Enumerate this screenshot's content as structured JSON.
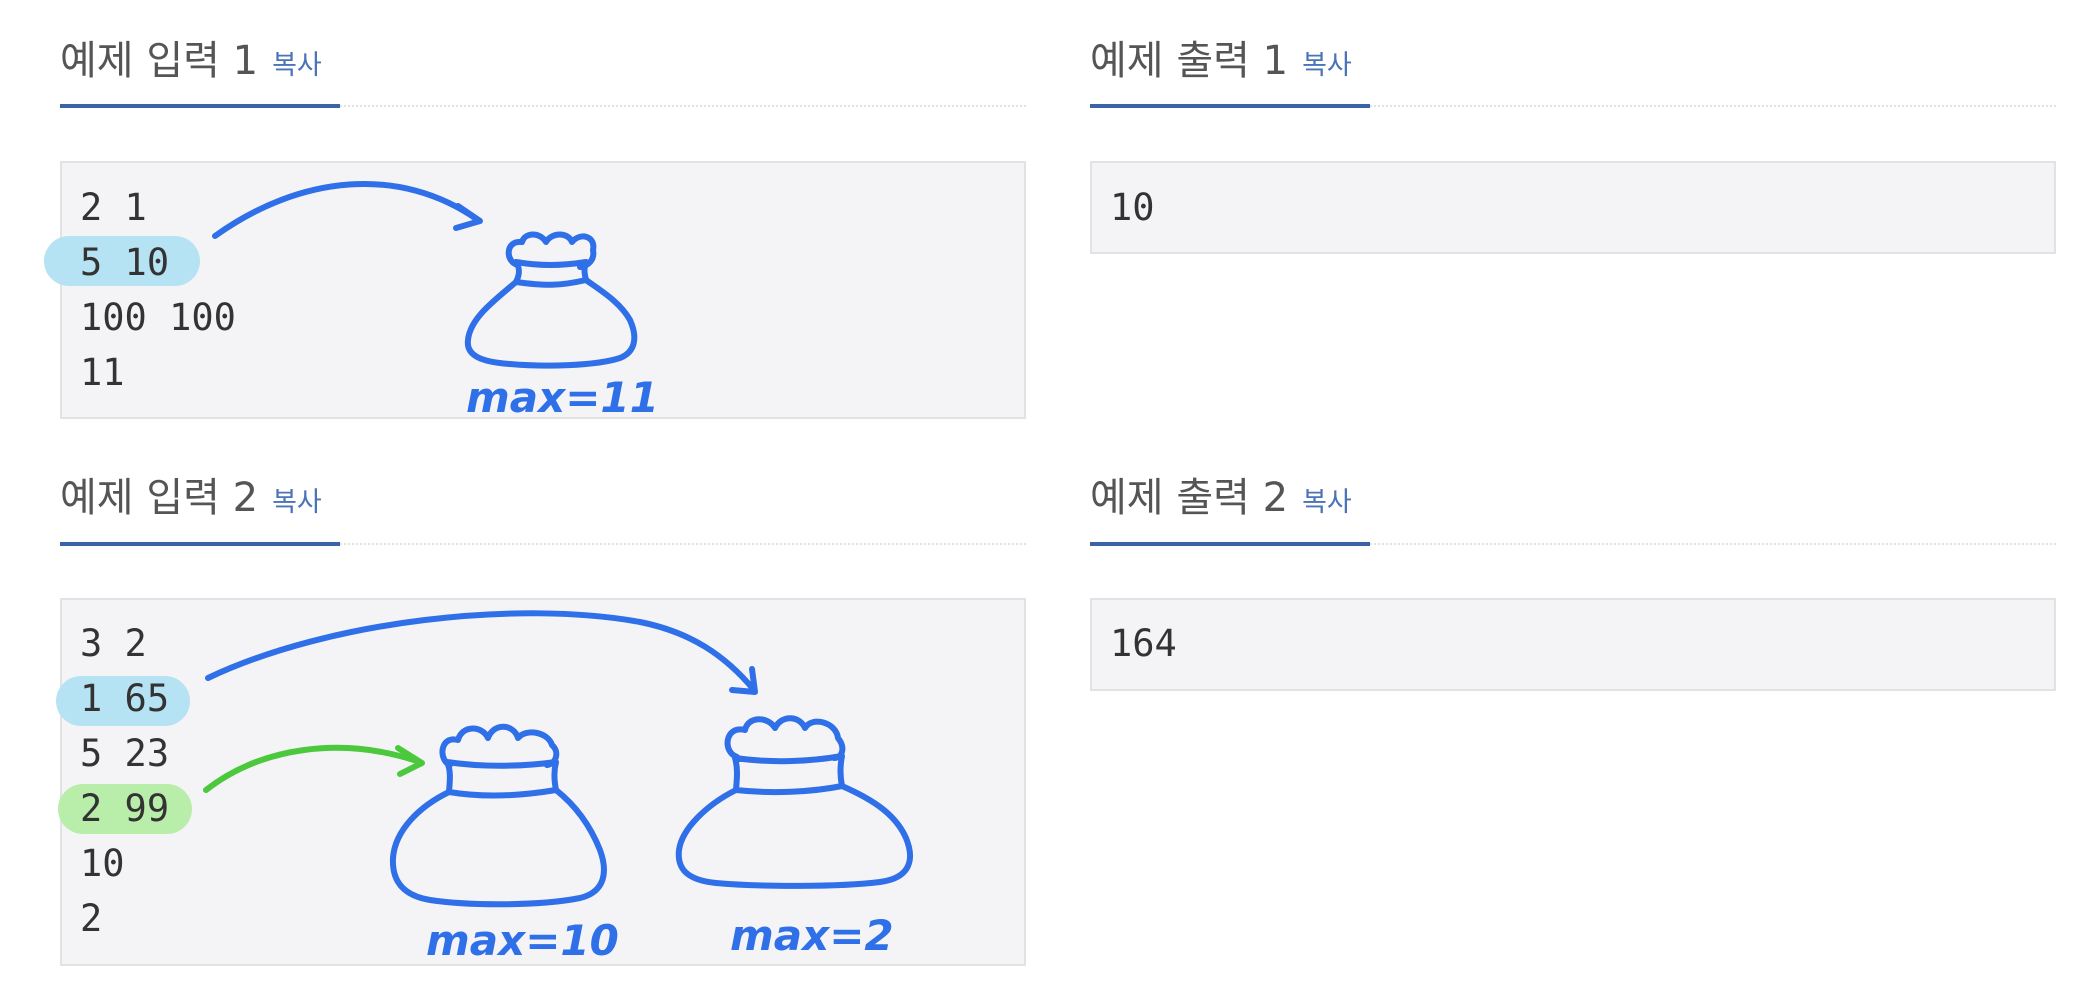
{
  "sample_input_1": {
    "title": "예제 입력 1",
    "copy_label": "복사",
    "lines": [
      "2 1",
      "5 10",
      "100 100",
      "11"
    ]
  },
  "sample_output_1": {
    "title": "예제 출력 1",
    "copy_label": "복사",
    "lines": [
      "10"
    ]
  },
  "sample_input_2": {
    "title": "예제 입력 2",
    "copy_label": "복사",
    "lines": [
      "3 2",
      "1 65",
      "5 23",
      "2 99",
      "10",
      "2"
    ]
  },
  "sample_output_2": {
    "title": "예제 출력 2",
    "copy_label": "복사",
    "lines": [
      "164"
    ]
  },
  "annotations": {
    "bag_1_label": "max=11",
    "bag_2_label": "max=10",
    "bag_3_label": "max=2",
    "colors": {
      "blue_ink": "#2f6fe8",
      "green_ink": "#4cc83c",
      "blue_highlight": "#b6e3f4",
      "green_highlight": "#b8edaa",
      "accent_underline": "#3a63a8",
      "copy_link": "#4a73b8"
    }
  }
}
